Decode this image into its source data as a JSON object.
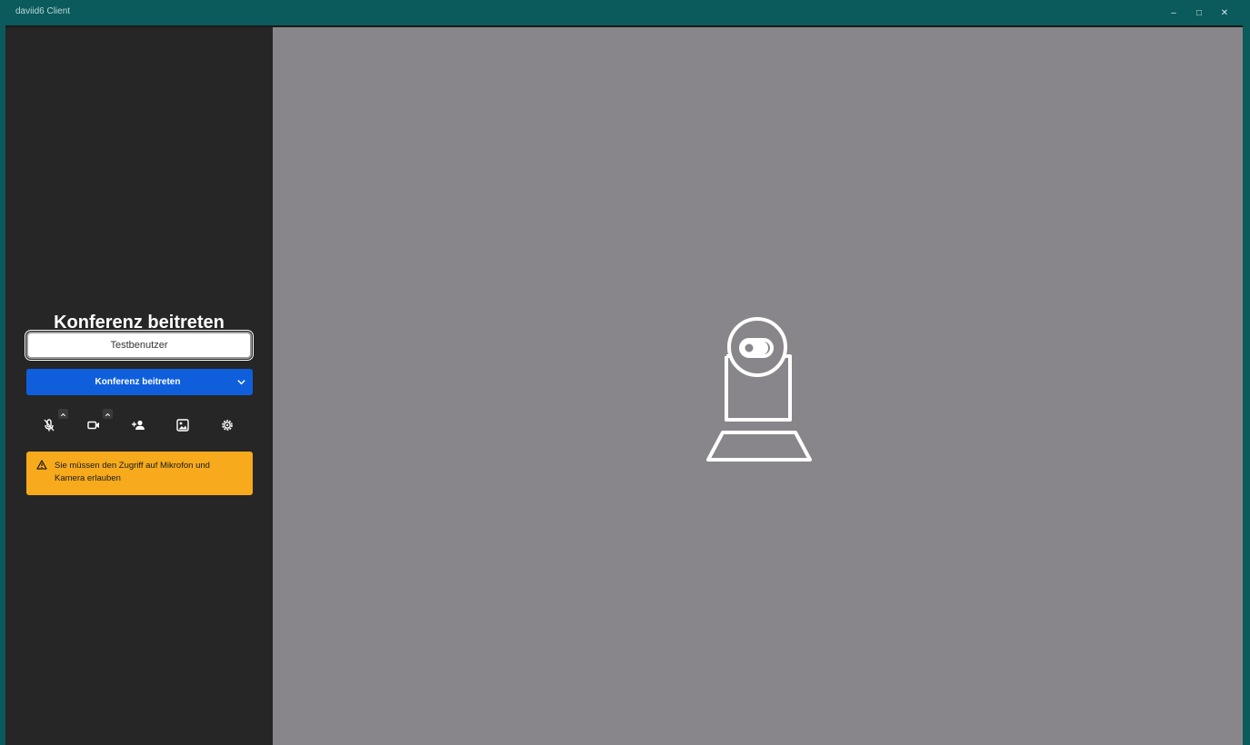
{
  "window": {
    "title": "daviid6 Client",
    "controls": {
      "minimize": "–",
      "maximize": "□",
      "close": "✕"
    }
  },
  "join": {
    "heading": "Konferenz beitreten",
    "name_value": "Testbenutzer",
    "button_label": "Konferenz beitreten"
  },
  "toolbar": {
    "icons": [
      "microphone-icon",
      "camera-icon",
      "invite-person-icon",
      "background-icon",
      "settings-icon"
    ]
  },
  "warning": {
    "text": "Sie müssen den Zugriff auf Mikrofon und Kamera erlauben"
  },
  "colors": {
    "titlebar": "#0b5a5c",
    "sidebar": "#262626",
    "stage": "#88868a",
    "primary": "#0f5fdd",
    "warning": "#f6aa1c"
  }
}
